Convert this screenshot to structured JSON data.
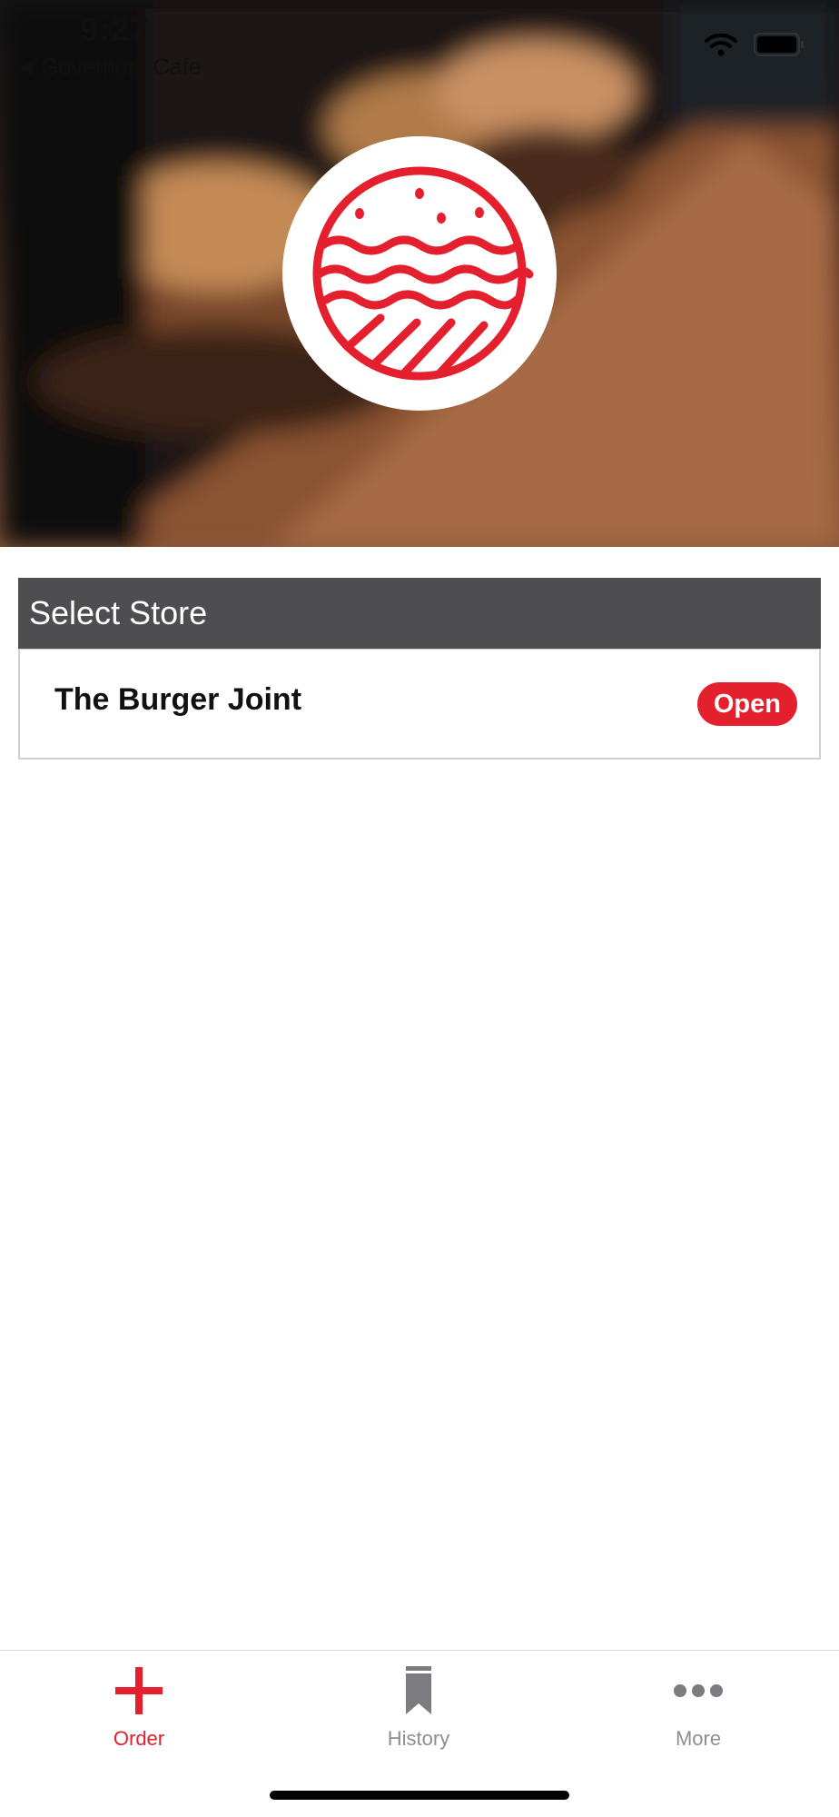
{
  "status_bar": {
    "time": "9:27",
    "back_label": "Governors Cafe"
  },
  "hero": {
    "logo_icon": "burger-logo-icon",
    "brand_color": "#e5202e"
  },
  "section": {
    "title": "Select Store"
  },
  "stores": [
    {
      "name": "The Burger Joint",
      "status": "Open"
    }
  ],
  "tab_bar": {
    "tabs": [
      {
        "label": "Order",
        "icon": "plus-icon",
        "active": true
      },
      {
        "label": "History",
        "icon": "bookmark-icon",
        "active": false
      },
      {
        "label": "More",
        "icon": "ellipsis-icon",
        "active": false
      }
    ]
  },
  "colors": {
    "accent": "#e5202e",
    "header_bg": "#4e4e50",
    "inactive_tab": "#8e8e93"
  }
}
